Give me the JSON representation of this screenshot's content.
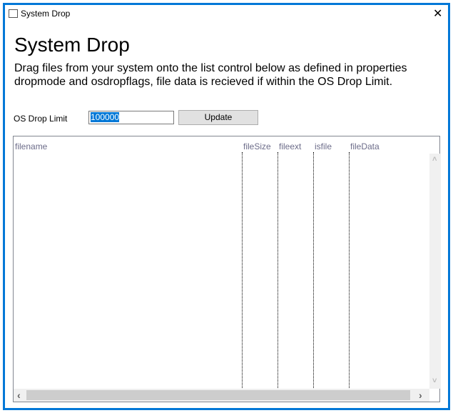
{
  "window": {
    "title": "System Drop",
    "close_icon": "close-icon"
  },
  "heading": "System Drop",
  "description": "Drag files from your system onto the list control below as defined in properties dropmode and osdropflags, file data is recieved if within the OS Drop Limit.",
  "limit": {
    "label": "OS Drop Limit",
    "value": "100000",
    "button": "Update"
  },
  "list": {
    "columns": [
      "filename",
      "fileSize",
      "fileext",
      "isfile",
      "fileData"
    ],
    "rows": []
  },
  "scroll": {
    "up": "˄",
    "down": "˅",
    "left": "‹",
    "right": "›"
  },
  "colors": {
    "accent": "#0078d7"
  }
}
